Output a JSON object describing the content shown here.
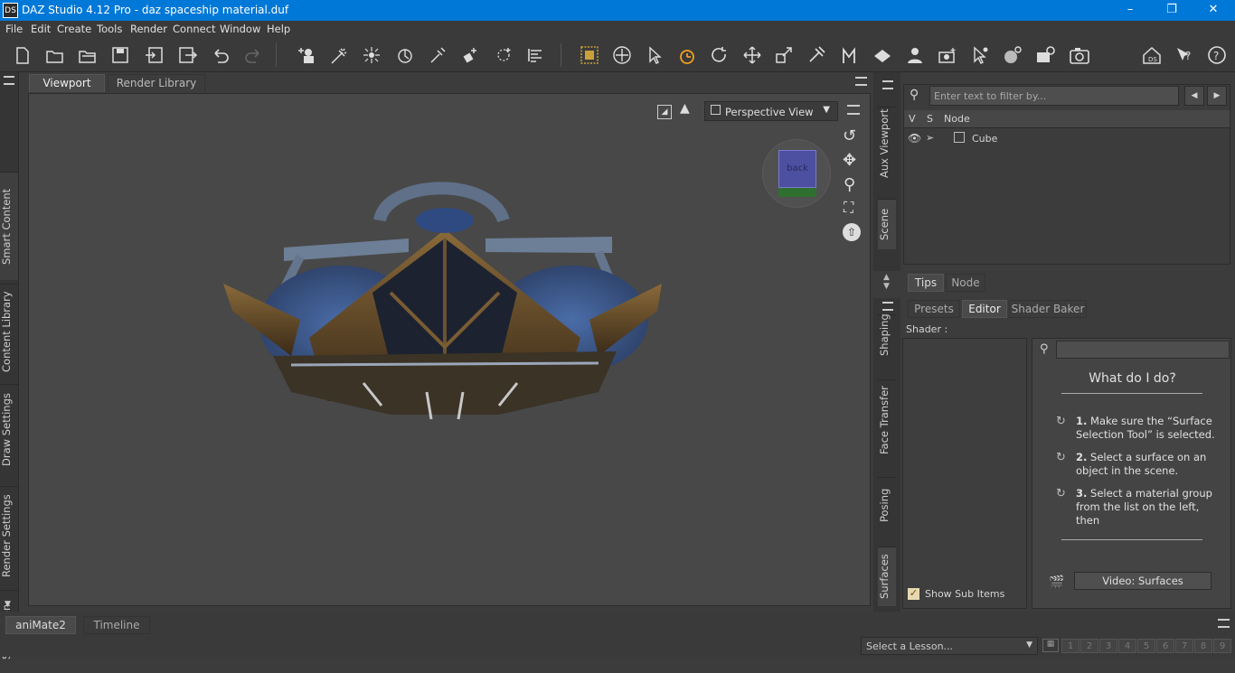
{
  "window": {
    "app_logo": "DS",
    "title": "DAZ Studio 4.12 Pro - daz spaceship material.duf"
  },
  "menu": [
    "File",
    "Edit",
    "Create",
    "Tools",
    "Render",
    "Connect",
    "Window",
    "Help"
  ],
  "toolbar_icons": [
    "new-file",
    "open",
    "open-folder",
    "save",
    "import",
    "export",
    "undo",
    "redo",
    "scene-add",
    "light-spot",
    "light-point",
    "light-distant",
    "light-bulb",
    "joint",
    "align",
    "grid",
    "universal-tool",
    "select",
    "node-rotate",
    "rotate",
    "translate",
    "scale",
    "brush",
    "morph",
    "surface",
    "figure",
    "camera-tools",
    "node-edit",
    "geometry",
    "render-settings",
    "render",
    "home",
    "help-whats-this",
    "help"
  ],
  "left_tabs": [
    "Smart Content",
    "Content Library",
    "Draw Settings",
    "Render Settings",
    "Simulation"
  ],
  "main_tabs": [
    "Viewport",
    "Render Library"
  ],
  "viewport": {
    "view_label": "Perspective View",
    "cube_label": "back"
  },
  "scene_tabs_vertical": [
    "Aux Viewport",
    "Scene"
  ],
  "scene": {
    "filter_placeholder": "Enter text to filter by...",
    "columns": [
      "V",
      "S",
      "Node"
    ],
    "rows": [
      {
        "name": "Cube"
      }
    ]
  },
  "lower_tabs": [
    "Tips",
    "Node"
  ],
  "surfaces_vtabs": [
    "Shaping",
    "Face Transfer",
    "Posing",
    "Surfaces"
  ],
  "surfaces": {
    "tabs": [
      "Presets",
      "Editor",
      "Shader Baker"
    ],
    "shader_label": "Shader :",
    "show_sub_items": "Show Sub Items",
    "help_title": "What do I do?",
    "steps": [
      {
        "num": "1.",
        "text": "Make sure the “Surface Selection Tool” is selected."
      },
      {
        "num": "2.",
        "text": "Select a surface on an object in the scene."
      },
      {
        "num": "3.",
        "text": "Select a material group from the list on the left, then"
      }
    ],
    "video_button": "Video: Surfaces"
  },
  "bottom_tabs": [
    "aniMate2",
    "Timeline"
  ],
  "lesson": {
    "placeholder": "Select a Lesson...",
    "pages": [
      "1",
      "2",
      "3",
      "4",
      "5",
      "6",
      "7",
      "8",
      "9"
    ]
  },
  "colors": {
    "titlebar": "#0078d7",
    "accent_orange": "#f0a020",
    "panel": "#3c3c3c"
  }
}
